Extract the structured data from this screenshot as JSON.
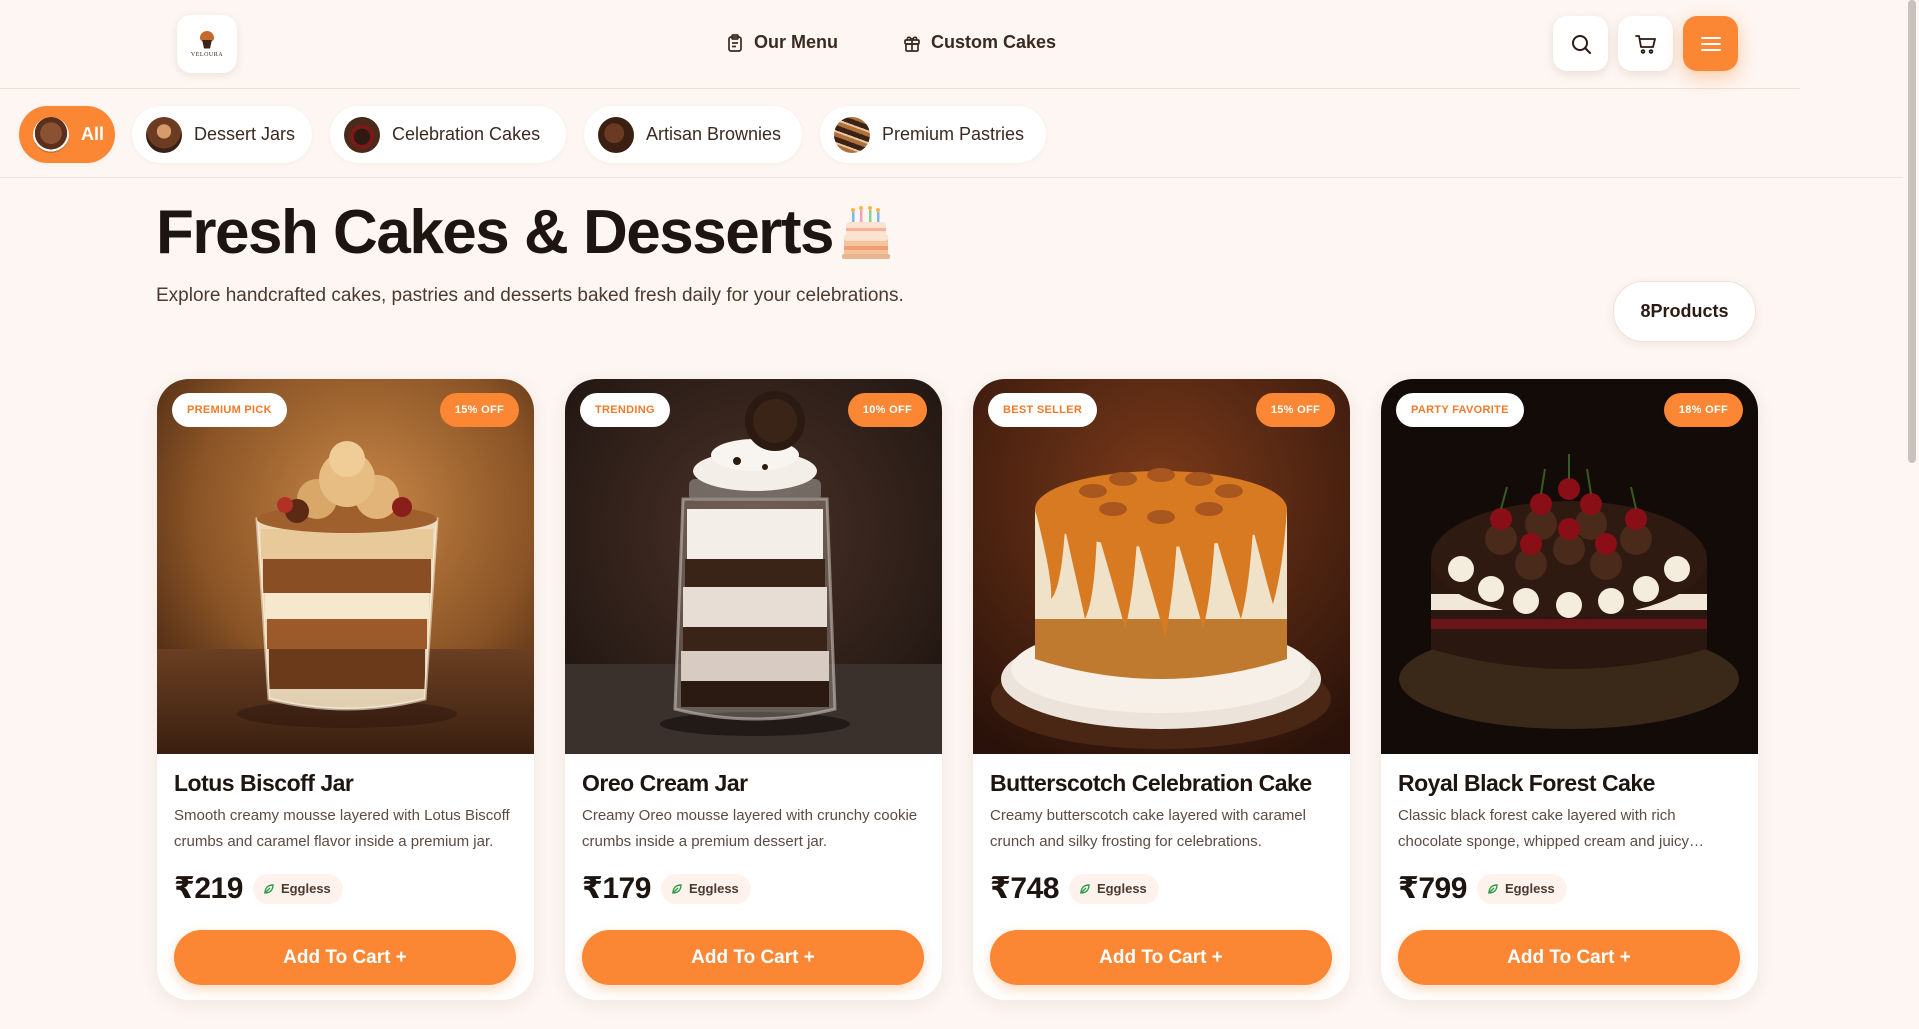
{
  "brand": {
    "logo_text": "VELOURA"
  },
  "nav": {
    "menu_label": "Our Menu",
    "custom_label": "Custom Cakes"
  },
  "categories": [
    {
      "label": "All",
      "active": true
    },
    {
      "label": "Dessert Jars",
      "active": false
    },
    {
      "label": "Celebration Cakes",
      "active": false
    },
    {
      "label": "Artisan Brownies",
      "active": false
    },
    {
      "label": "Premium Pastries",
      "active": false
    }
  ],
  "hero": {
    "title": "Fresh Cakes & Desserts",
    "subtitle": "Explore handcrafted cakes, pastries and desserts baked fresh daily for your celebrations.",
    "count": "8Products"
  },
  "products": [
    {
      "tag": "PREMIUM PICK",
      "discount": "15% OFF",
      "name": "Lotus Biscoff Jar",
      "desc": "Smooth creamy mousse layered with Lotus Biscoff crumbs and caramel flavor inside a premium jar.",
      "price": "₹219",
      "diet": "Eggless",
      "cta": "Add To Cart +"
    },
    {
      "tag": "TRENDING",
      "discount": "10% OFF",
      "name": "Oreo Cream Jar",
      "desc": "Creamy Oreo mousse layered with crunchy cookie crumbs inside a premium dessert jar.",
      "price": "₹179",
      "diet": "Eggless",
      "cta": "Add To Cart +"
    },
    {
      "tag": "BEST SELLER",
      "discount": "15% OFF",
      "name": "Butterscotch Celebration Cake",
      "desc": "Creamy butterscotch cake layered with caramel crunch and silky frosting for celebrations.",
      "price": "₹748",
      "diet": "Eggless",
      "cta": "Add To Cart +"
    },
    {
      "tag": "PARTY FAVORITE",
      "discount": "18% OFF",
      "name": "Royal Black Forest Cake",
      "desc": "Classic black forest cake layered with rich chocolate sponge, whipped cream and juicy cherries.",
      "price": "₹799",
      "diet": "Eggless",
      "cta": "Add To Cart +"
    }
  ],
  "colors": {
    "accent": "#fb8633",
    "background": "#fdf6f2",
    "text": "#1e1410"
  }
}
